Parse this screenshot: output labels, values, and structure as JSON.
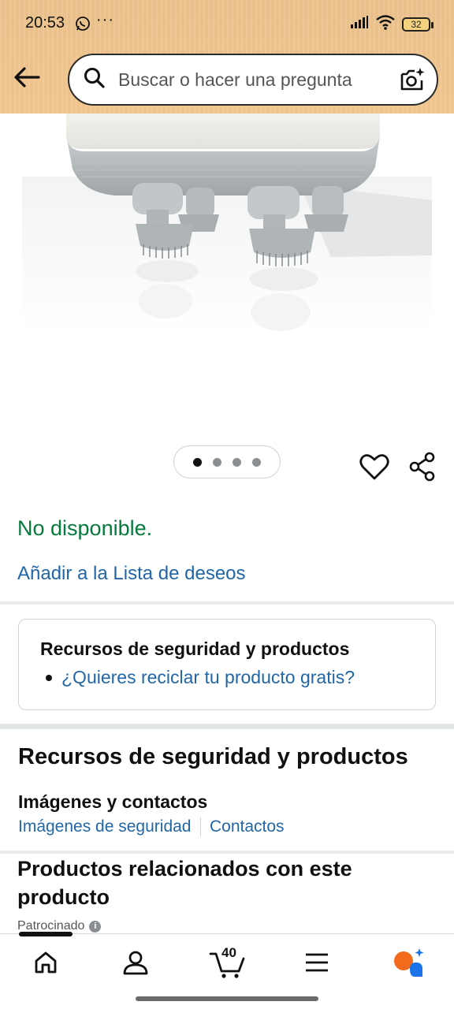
{
  "status_bar": {
    "time": "20:53",
    "dots": "···",
    "battery": "32"
  },
  "header": {
    "search_placeholder": "Buscar o hacer una pregunta"
  },
  "carousel": {
    "total_dots": 4,
    "active_index": 0
  },
  "product": {
    "availability": "No disponible.",
    "wishlist_link": "Añadir a la Lista de deseos"
  },
  "safety_box": {
    "title": "Recursos de seguridad y productos",
    "link": "¿Quieres reciclar tu producto gratis?"
  },
  "resources_section": {
    "title": "Recursos de seguridad y productos",
    "subtitle": "Imágenes y contactos",
    "links": [
      "Imágenes de seguridad",
      "Contactos"
    ]
  },
  "related": {
    "title": "Productos relacionados con este producto",
    "sponsored": "Patrocinado"
  },
  "bottom_nav": {
    "cart_count": "40",
    "items": [
      "home-icon",
      "account-icon",
      "cart-icon",
      "menu-icon",
      "assistant-icon"
    ]
  },
  "colors": {
    "header_bg": "#f0c48d",
    "availability_green": "#047b3b",
    "link_blue": "#2167a7"
  }
}
